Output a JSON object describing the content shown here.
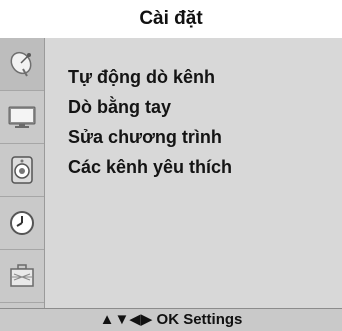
{
  "header": {
    "title": "Cài đặt"
  },
  "sidebar": {
    "icons": [
      "satellite-dish-icon",
      "tv-screen-icon",
      "speaker-icon",
      "clock-icon",
      "toolbox-icon"
    ]
  },
  "menu": {
    "items": [
      {
        "label": "Tự động dò kênh"
      },
      {
        "label": "Dò bằng tay"
      },
      {
        "label": "Sửa chương trình"
      },
      {
        "label": "Các kênh yêu thích"
      }
    ]
  },
  "footer": {
    "hint": "▲▼◀▶ OK  Settings"
  },
  "colors": {
    "panel": "#d8d8d8",
    "sidebar": "#c9c9c9",
    "text": "#141414"
  }
}
